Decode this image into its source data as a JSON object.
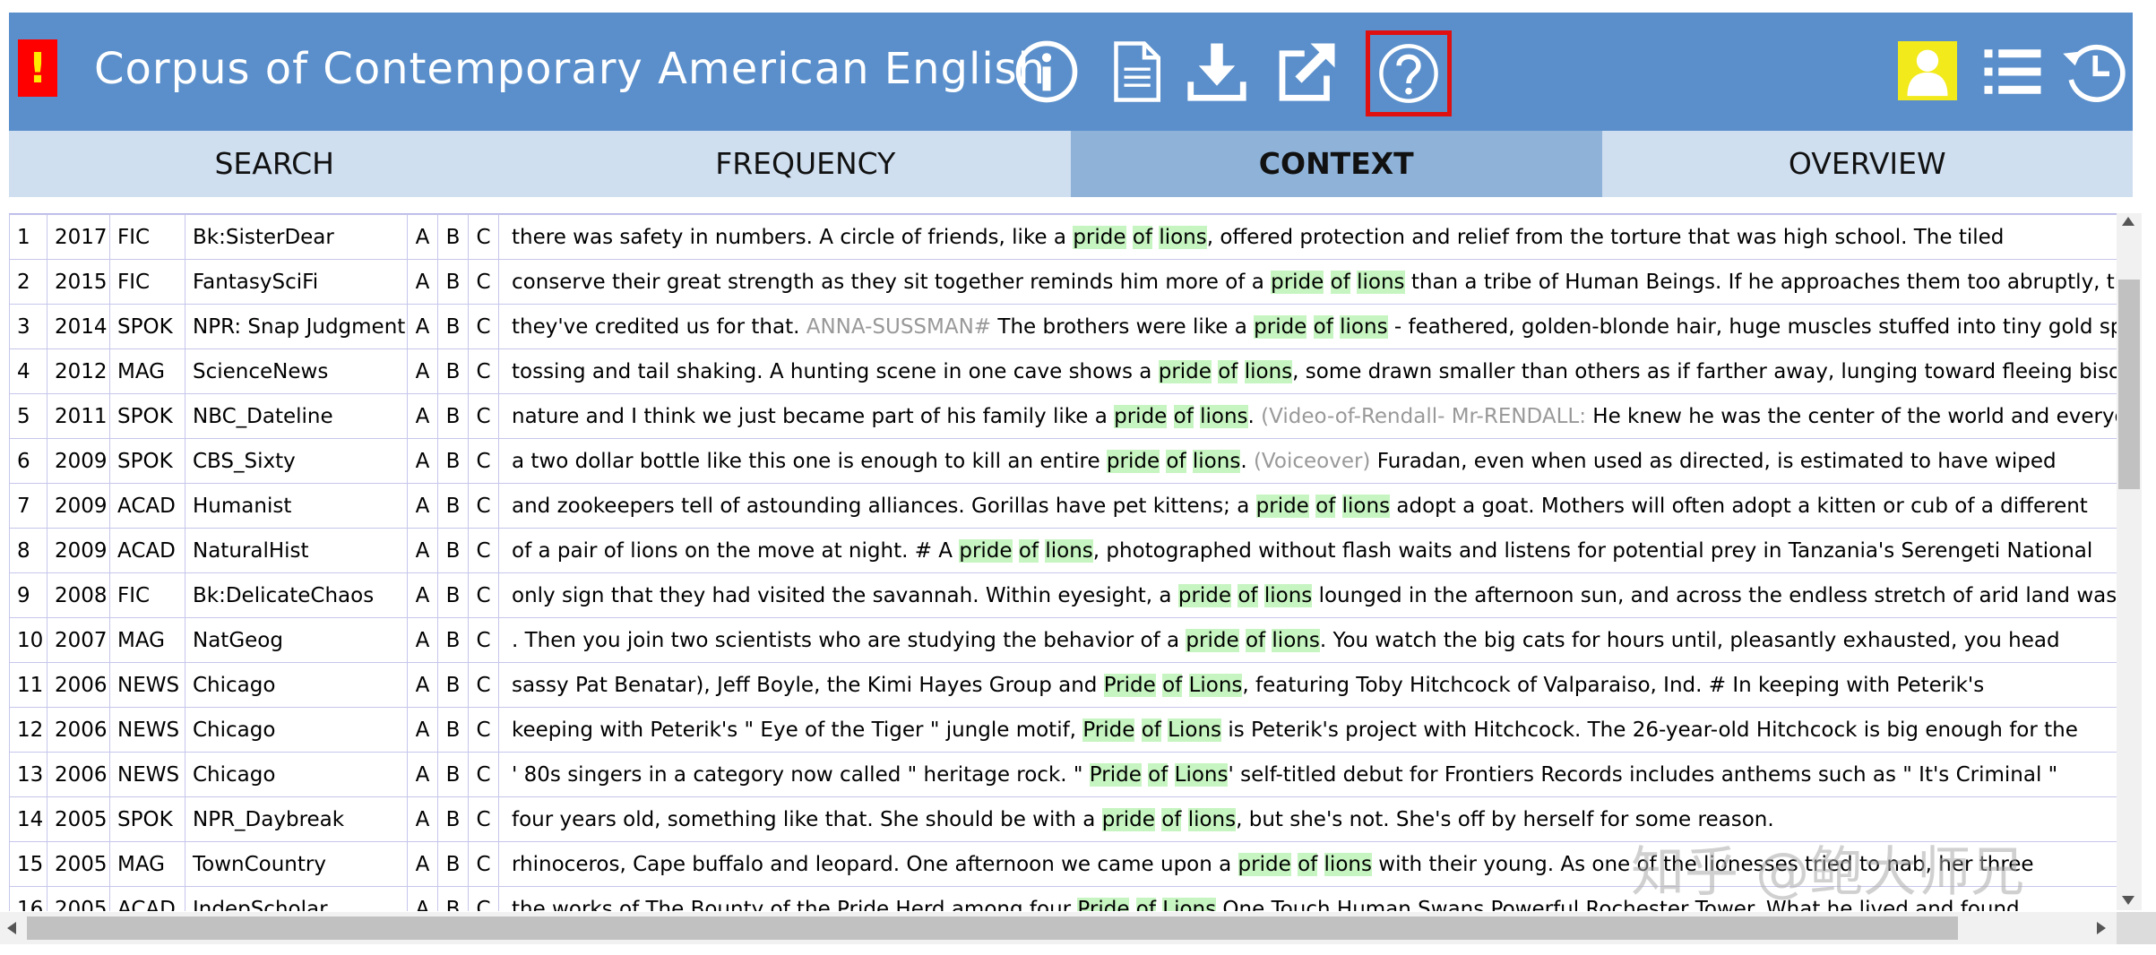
{
  "header": {
    "alert_label": "!",
    "title": "Corpus of Contemporary American English",
    "colors": {
      "bar": "#5a8fcb",
      "alert_bg": "#ff0000",
      "alert_fg": "#ffea00",
      "help_border": "#e01010",
      "user_bg": "#f2ea1a"
    },
    "icons": [
      "info-icon",
      "document-icon",
      "download-icon",
      "external-link-icon",
      "help-icon",
      "user-icon",
      "list-icon",
      "history-icon"
    ]
  },
  "tabs": [
    {
      "label": "SEARCH"
    },
    {
      "label": "FREQUENCY"
    },
    {
      "label": "CONTEXT",
      "active": true
    },
    {
      "label": "OVERVIEW"
    }
  ],
  "results": [
    {
      "n": "1",
      "year": "2017",
      "genre": "FIC",
      "source": "Bk:SisterDear",
      "ctx": [
        [
          "there was safety in numbers. A circle of friends, like a ",
          ""
        ],
        [
          "pride",
          "hl"
        ],
        [
          " ",
          ""
        ],
        [
          "of",
          "hl"
        ],
        [
          " ",
          ""
        ],
        [
          "lions",
          "hl"
        ],
        [
          ", offered protection and relief from the torture that was high school. The tiled",
          ""
        ]
      ]
    },
    {
      "n": "2",
      "year": "2015",
      "genre": "FIC",
      "source": "FantasySciFi",
      "ctx": [
        [
          "conserve their great strength as they sit together reminds him more of a ",
          ""
        ],
        [
          "pride",
          "hl"
        ],
        [
          " ",
          ""
        ],
        [
          "of",
          "hl"
        ],
        [
          " ",
          ""
        ],
        [
          "lions",
          "hl"
        ],
        [
          " than a tribe of Human Beings. If he approaches them too abruptly, they",
          ""
        ]
      ]
    },
    {
      "n": "3",
      "year": "2014",
      "genre": "SPOK",
      "source": "NPR: Snap Judgment",
      "ctx": [
        [
          "they've credited us for that. ",
          ""
        ],
        [
          "ANNA-SUSSMAN#",
          "gray"
        ],
        [
          " The brothers were like a ",
          ""
        ],
        [
          "pride",
          "hl"
        ],
        [
          " ",
          ""
        ],
        [
          "of",
          "hl"
        ],
        [
          " ",
          ""
        ],
        [
          "lions",
          "hl"
        ],
        [
          " - feathered, golden-blonde hair, huge muscles stuffed into tiny gold spandex",
          ""
        ]
      ]
    },
    {
      "n": "4",
      "year": "2012",
      "genre": "MAG",
      "source": "ScienceNews",
      "ctx": [
        [
          "tossing and tail shaking. A hunting scene in one cave shows a ",
          ""
        ],
        [
          "pride",
          "hl"
        ],
        [
          " ",
          ""
        ],
        [
          "of",
          "hl"
        ],
        [
          " ",
          ""
        ],
        [
          "lions",
          "hl"
        ],
        [
          ", some drawn smaller than others as if farther away, lunging toward fleeing bison",
          ""
        ]
      ]
    },
    {
      "n": "5",
      "year": "2011",
      "genre": "SPOK",
      "source": "NBC_Dateline",
      "ctx": [
        [
          "nature and I think we just became part of his family like a ",
          ""
        ],
        [
          "pride",
          "hl"
        ],
        [
          " ",
          ""
        ],
        [
          "of",
          "hl"
        ],
        [
          " ",
          ""
        ],
        [
          "lions",
          "hl"
        ],
        [
          ". ",
          ""
        ],
        [
          "(Video-of-Rendall- Mr-RENDALL:",
          "gray"
        ],
        [
          " He knew he was the center of the world and everyone",
          ""
        ]
      ]
    },
    {
      "n": "6",
      "year": "2009",
      "genre": "SPOK",
      "source": "CBS_Sixty",
      "ctx": [
        [
          "a two dollar bottle like this one is enough to kill an entire ",
          ""
        ],
        [
          "pride",
          "hl"
        ],
        [
          " ",
          ""
        ],
        [
          "of",
          "hl"
        ],
        [
          " ",
          ""
        ],
        [
          "lions",
          "hl"
        ],
        [
          ". ",
          ""
        ],
        [
          "(Voiceover)",
          "gray"
        ],
        [
          " Furadan, even when used as directed, is estimated to have wiped",
          ""
        ]
      ]
    },
    {
      "n": "7",
      "year": "2009",
      "genre": "ACAD",
      "source": "Humanist",
      "ctx": [
        [
          "and zookeepers tell of astounding alliances. Gorillas have pet kittens; a ",
          ""
        ],
        [
          "pride",
          "hl"
        ],
        [
          " ",
          ""
        ],
        [
          "of",
          "hl"
        ],
        [
          " ",
          ""
        ],
        [
          "lions",
          "hl"
        ],
        [
          " adopt a goat. Mothers will often adopt a kitten or cub of a different",
          ""
        ]
      ]
    },
    {
      "n": "8",
      "year": "2009",
      "genre": "ACAD",
      "source": "NaturalHist",
      "ctx": [
        [
          "of a pair of lions on the move at night. # A ",
          ""
        ],
        [
          "pride",
          "hl"
        ],
        [
          " ",
          ""
        ],
        [
          "of",
          "hl"
        ],
        [
          " ",
          ""
        ],
        [
          "lions",
          "hl"
        ],
        [
          ", photographed without flash waits and listens for potential prey in Tanzania's Serengeti National",
          ""
        ]
      ]
    },
    {
      "n": "9",
      "year": "2008",
      "genre": "FIC",
      "source": "Bk:DelicateChaos",
      "ctx": [
        [
          "only sign that they had visited the savannah. Within eyesight, a ",
          ""
        ],
        [
          "pride",
          "hl"
        ],
        [
          " ",
          ""
        ],
        [
          "of",
          "hl"
        ],
        [
          " ",
          ""
        ],
        [
          "lions",
          "hl"
        ],
        [
          " lounged in the afternoon sun, and across the endless stretch of arid land was",
          ""
        ]
      ]
    },
    {
      "n": "10",
      "year": "2007",
      "genre": "MAG",
      "source": "NatGeog",
      "ctx": [
        [
          ". Then you join two scientists who are studying the behavior of a ",
          ""
        ],
        [
          "pride",
          "hl"
        ],
        [
          " ",
          ""
        ],
        [
          "of",
          "hl"
        ],
        [
          " ",
          ""
        ],
        [
          "lions",
          "hl"
        ],
        [
          ". You watch the big cats for hours until, pleasantly exhausted, you head",
          ""
        ]
      ]
    },
    {
      "n": "11",
      "year": "2006",
      "genre": "NEWS",
      "source": "Chicago",
      "ctx": [
        [
          "sassy Pat Benatar), Jeff Boyle, the Kimi Hayes Group and ",
          ""
        ],
        [
          "Pride",
          "hl"
        ],
        [
          " ",
          ""
        ],
        [
          "of",
          "hl"
        ],
        [
          " ",
          ""
        ],
        [
          "Lions",
          "hl"
        ],
        [
          ", featuring Toby Hitchcock of Valparaiso, Ind. # In keeping with Peterik's",
          ""
        ]
      ]
    },
    {
      "n": "12",
      "year": "2006",
      "genre": "NEWS",
      "source": "Chicago",
      "ctx": [
        [
          "keeping with Peterik's \" Eye of the Tiger \" jungle motif, ",
          ""
        ],
        [
          "Pride",
          "hl"
        ],
        [
          " ",
          ""
        ],
        [
          "of",
          "hl"
        ],
        [
          " ",
          ""
        ],
        [
          "Lions",
          "hl"
        ],
        [
          " is Peterik's project with Hitchcock. The 26-year-old Hitchcock is big enough for the",
          ""
        ]
      ]
    },
    {
      "n": "13",
      "year": "2006",
      "genre": "NEWS",
      "source": "Chicago",
      "ctx": [
        [
          "' 80s singers in a category now called \" heritage rock. \" ",
          ""
        ],
        [
          "Pride",
          "hl"
        ],
        [
          " ",
          ""
        ],
        [
          "of",
          "hl"
        ],
        [
          " ",
          ""
        ],
        [
          "Lions",
          "hl"
        ],
        [
          "' self-titled debut for Frontiers Records includes anthems such as \" It's Criminal \"",
          ""
        ]
      ]
    },
    {
      "n": "14",
      "year": "2005",
      "genre": "SPOK",
      "source": "NPR_Daybreak",
      "ctx": [
        [
          "four years old, something like that. She should be with a ",
          ""
        ],
        [
          "pride",
          "hl"
        ],
        [
          " ",
          ""
        ],
        [
          "of",
          "hl"
        ],
        [
          " ",
          ""
        ],
        [
          "lions",
          "hl"
        ],
        [
          ", but she's not. She's off by herself for some reason.",
          ""
        ]
      ]
    },
    {
      "n": "15",
      "year": "2005",
      "genre": "MAG",
      "source": "TownCountry",
      "ctx": [
        [
          "rhinoceros, Cape buffalo and leopard. One afternoon we came upon a ",
          ""
        ],
        [
          "pride",
          "hl"
        ],
        [
          " ",
          ""
        ],
        [
          "of",
          "hl"
        ],
        [
          " ",
          ""
        ],
        [
          "lions",
          "hl"
        ],
        [
          " with their young. As one of the lionesses tried to nab, her three",
          ""
        ]
      ]
    },
    {
      "n": "16",
      "year": "2005",
      "genre": "ACAD",
      "source": "IndepScholar",
      "ctx": [
        [
          "the works of The Bounty of the Pride Herd among four ",
          ""
        ],
        [
          "Pride",
          "hl"
        ],
        [
          " ",
          ""
        ],
        [
          "of",
          "hl"
        ],
        [
          " ",
          ""
        ],
        [
          "Lions",
          "hl"
        ],
        [
          " One Touch Human Swans Powerful Rochester Tower. What he lived and found",
          ""
        ]
      ]
    }
  ],
  "abc": [
    "A",
    "B",
    "C"
  ],
  "highlight_color": "#c7f5c1",
  "watermark": "知乎 @鲍大师兄"
}
